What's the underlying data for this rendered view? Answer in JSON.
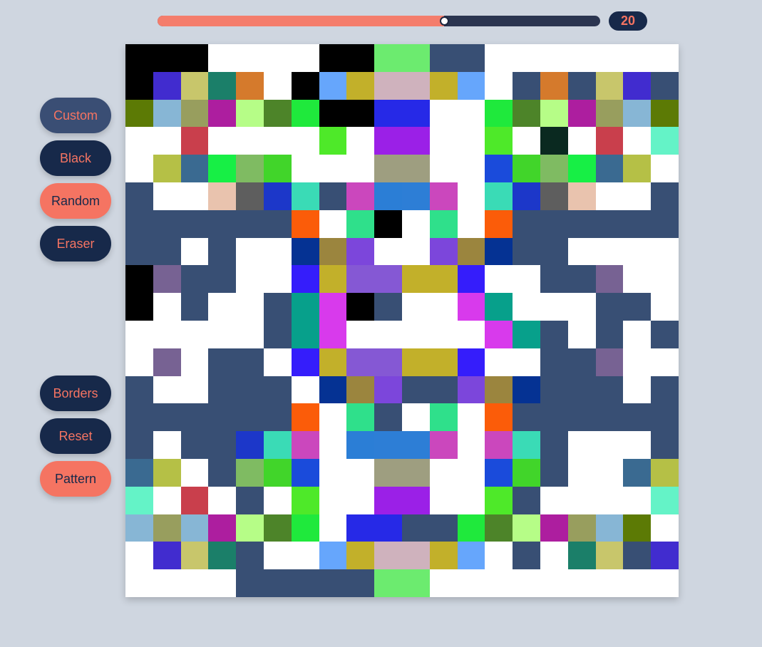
{
  "brush": {
    "size": "20",
    "slider_fraction": 0.6475
  },
  "buttons": {
    "custom": "Custom",
    "black": "Black",
    "random": "Random",
    "eraser": "Eraser",
    "borders": "Borders",
    "reset": "Reset",
    "pattern": "Pattern"
  },
  "colors": {
    "background": "#cfd6e0",
    "accent_coral": "#f57462",
    "dark_navy": "#17294a",
    "custom_blue": "#3a4e74",
    "grid_paint": "#384f74"
  },
  "canvas": {
    "rows": [
      "BBB....BBGGNN.......",
      "BIOPQ.BRSTTSR.NQNOIN",
      "UVWXYZaBBbb..aZYXWVU",
      "..c....d.ee..d.f.c.g",
      ".hijkl...mm..nlkjih.",
      "N..opqrNstus.rqpo..N",
      "NNNNNNv.wB.w.vNNNNNN",
      "NN.N..xyz..zyxNN....",
      "BANN..0S11SS0..NNA.",
      "B.N..N23BN..32...NN.",
      ".....N23.....32N.N.N",
      ".A.NN.0S11SS0..NNA.",
      "N..NNN xyzNNzyxNNN.NN",
      "NNNNNNv.wN.w.vNNNNNN",
      "N.NNqrs.tuus.srN...N",
      "ih.Nkln..mm..nlN..ih",
      "g.c.N.d..ee..dN....g",
      "VWVXYZa.bbNNaZYXWVU",
      ".IOPN..RSTTSR.N.PONI.",
      "....NNNNNGG........."
    ],
    "palette": {
      "B": "#000000",
      "G": "#6ceb6f",
      "N": "#384f74",
      "I": "#412ccf",
      "O": "#c8c66b",
      "P": "#1b7f69",
      "Q": "#d57a2c",
      "R": "#66a6fc",
      "S": "#c2b02a",
      "T": "#cfb2bd",
      "U": "#5c7a05",
      "V": "#87b6d5",
      "W": "#989e5e",
      "X": "#ad1e9f",
      "Y": "#b6fd87",
      "Z": "#4d8429",
      "a": "#1fe93c",
      "b": "#2629e7",
      "c": "#c93f4c",
      "d": "#4ee929",
      "e": "#9b20e7",
      "f": "#0a2920",
      "g": "#64f3c7",
      "h": "#b5c046",
      "i": "#3a6a91",
      "j": "#17ef45",
      "k": "#7fbb62",
      "l": "#41d52a",
      "m": "#9e9e80",
      "n": "#1a4bdb",
      "o": "#e9c3ae",
      "p": "#5e5e5e",
      "q": "#1c37c9",
      "r": "#3adbb6",
      "s": "#cb47bd",
      "t": "#2b7ed6",
      "u": "#2d7ed6",
      "v": "#fb5c09",
      "w": "#2fe08b",
      "x": "#053293",
      "y": "#9b853e",
      "z": "#7c46db",
      "A": "#776293",
      "0": "#351dfb",
      "1": "#8558d4",
      "2": "#07a08b",
      "3": "#d83aec",
      "4": "#ffffff",
      ".": "#ffffff",
      " ": "#ffffff"
    }
  }
}
